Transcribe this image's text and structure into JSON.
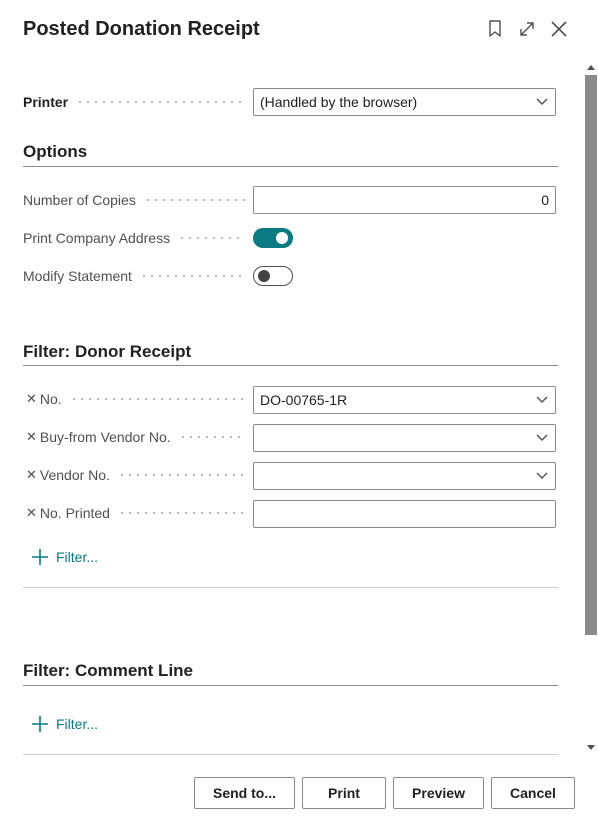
{
  "header": {
    "title": "Posted Donation Receipt"
  },
  "printer": {
    "label": "Printer",
    "value": "(Handled by the browser)"
  },
  "options": {
    "heading": "Options",
    "number_of_copies": {
      "label": "Number of Copies",
      "value": "0"
    },
    "print_company_address": {
      "label": "Print Company Address",
      "on": true
    },
    "modify_statement": {
      "label": "Modify Statement",
      "on": false
    }
  },
  "filter_donor_receipt": {
    "heading": "Filter: Donor Receipt",
    "fields": [
      {
        "label": "No.",
        "value": "DO-00765-1R",
        "dropdown": true
      },
      {
        "label": "Buy-from Vendor No.",
        "value": "",
        "dropdown": true
      },
      {
        "label": "Vendor No.",
        "value": "",
        "dropdown": true
      },
      {
        "label": "No. Printed",
        "value": "",
        "dropdown": false
      }
    ],
    "add_filter_label": "Filter..."
  },
  "filter_comment_line": {
    "heading": "Filter: Comment Line",
    "add_filter_label": "Filter..."
  },
  "footer": {
    "send_to_label": "Send to...",
    "print_label": "Print",
    "preview_label": "Preview",
    "cancel_label": "Cancel"
  },
  "colors": {
    "accent": "#0a7b83",
    "border": "#8a8a8a",
    "text": "#212121",
    "label_text": "#505050"
  },
  "icons": [
    "bookmark-icon",
    "expand-icon",
    "close-icon",
    "chevron-down-icon",
    "remove-filter-icon",
    "plus-icon"
  ]
}
